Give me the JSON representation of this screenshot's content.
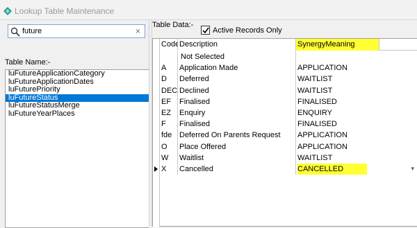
{
  "window": {
    "title": "Lookup Table Maintenance"
  },
  "search": {
    "value": "future",
    "clear_symbol": "×"
  },
  "left": {
    "table_name_label": "Table Name:-",
    "tables": [
      {
        "label": "luFutureApplicationCategory",
        "selected": false
      },
      {
        "label": "luFutureApplicationDates",
        "selected": false
      },
      {
        "label": "luFuturePriority",
        "selected": false
      },
      {
        "label": "luFutureStatus",
        "selected": true
      },
      {
        "label": "luFutureStatusMerge",
        "selected": false
      },
      {
        "label": "luFutureYearPlaces",
        "selected": false
      }
    ]
  },
  "right": {
    "table_data_label": "Table Data:-",
    "active_records_label": "Active Records Only",
    "active_records_checked": true
  },
  "grid": {
    "columns": [
      "Code",
      "Description",
      "SynergyMeaning"
    ],
    "rows": [
      {
        "code": "",
        "description": "Not Selected",
        "meaning": ""
      },
      {
        "code": "A",
        "description": "Application Made",
        "meaning": "APPLICATION"
      },
      {
        "code": "D",
        "description": "Deferred",
        "meaning": "WAITLIST"
      },
      {
        "code": "DEC",
        "description": "Declined",
        "meaning": "WAITLIST"
      },
      {
        "code": "EF",
        "description": "Finalised",
        "meaning": "FINALISED"
      },
      {
        "code": "EZ",
        "description": "Enquiry",
        "meaning": "ENQUIRY"
      },
      {
        "code": "F",
        "description": "Finalised",
        "meaning": "FINALISED"
      },
      {
        "code": "fde",
        "description": "Deferred On Parents Request",
        "meaning": "APPLICATION"
      },
      {
        "code": "O",
        "description": "Place Offered",
        "meaning": "APPLICATION"
      },
      {
        "code": "W",
        "description": "Waitlist",
        "meaning": "WAITLIST"
      },
      {
        "code": "X",
        "description": "Cancelled",
        "meaning": "CANCELLED"
      }
    ],
    "current_row_index": 10
  },
  "colors": {
    "highlight": "#ffff33",
    "selection": "#0078d7",
    "title_text": "#9a9a9a",
    "app_icon": "#2b9c8e"
  },
  "icons": {
    "app": "diamond-app-icon",
    "search": "magnifier-icon",
    "checkbox": "checkmark-icon",
    "row_pointer": "triangle-right-icon",
    "dropdown": "chevron-down-icon"
  }
}
